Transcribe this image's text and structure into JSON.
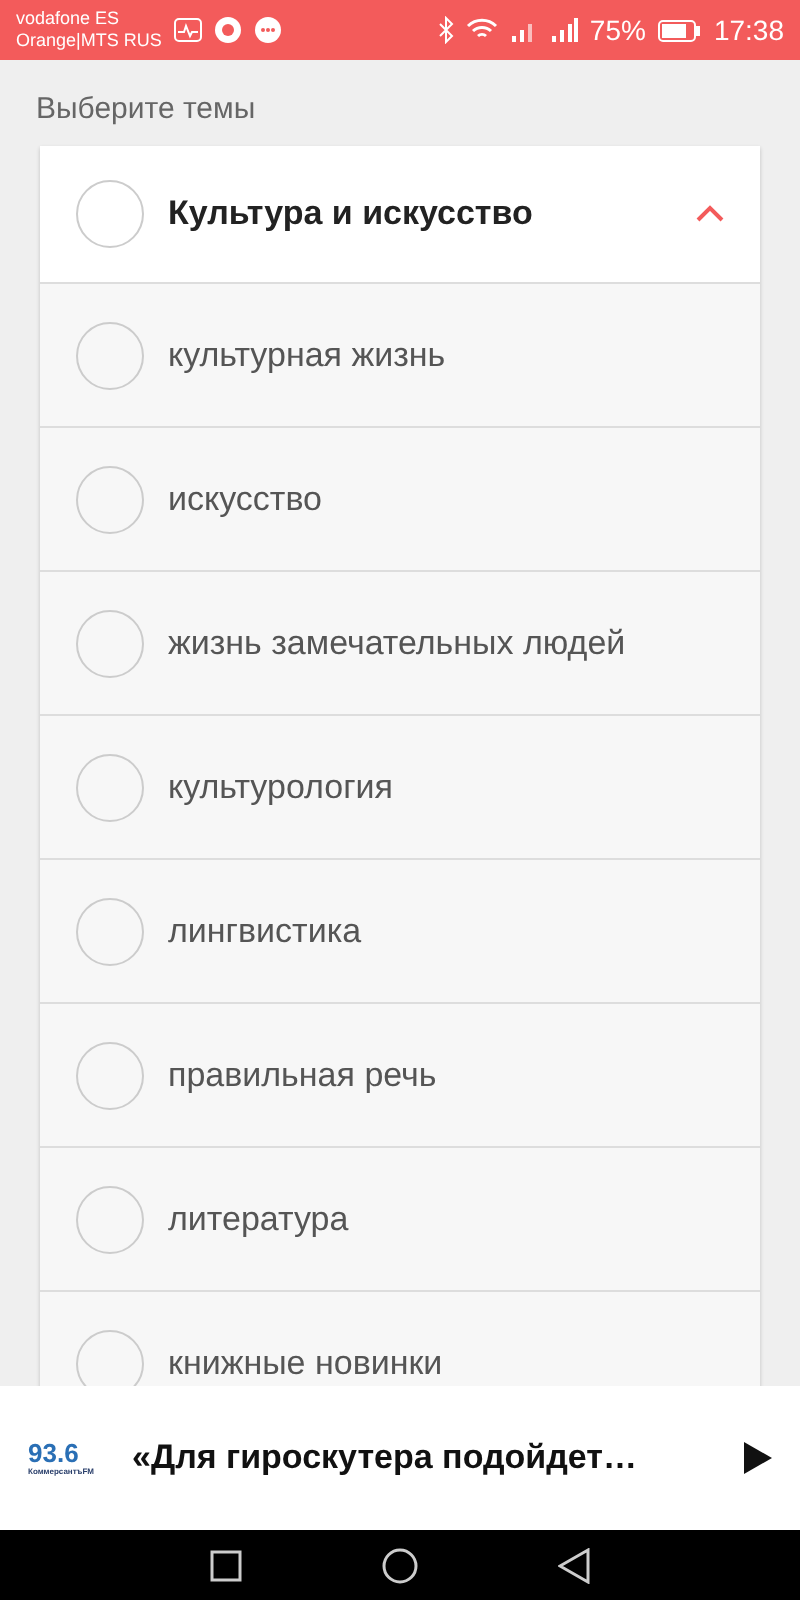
{
  "status_bar": {
    "carriers": [
      "vodafone ES",
      "Orange|MTS RUS"
    ],
    "battery": "75%",
    "time": "17:38"
  },
  "heading": "Выберите темы",
  "category": {
    "title": "Культура и искусство",
    "checked": false,
    "expanded": true,
    "children": [
      {
        "label": "культурная жизнь",
        "checked": false
      },
      {
        "label": "искусство",
        "checked": false
      },
      {
        "label": "жизнь замечательных людей",
        "checked": false
      },
      {
        "label": "культурология",
        "checked": false
      },
      {
        "label": "лингвистика",
        "checked": false
      },
      {
        "label": "правильная речь",
        "checked": false
      },
      {
        "label": "литература",
        "checked": false
      },
      {
        "label": "книжные новинки",
        "checked": false
      }
    ]
  },
  "player": {
    "station": "93.6",
    "station_name": "КоммерсантъFM",
    "title": "«Для гироскутера подойдет…"
  }
}
